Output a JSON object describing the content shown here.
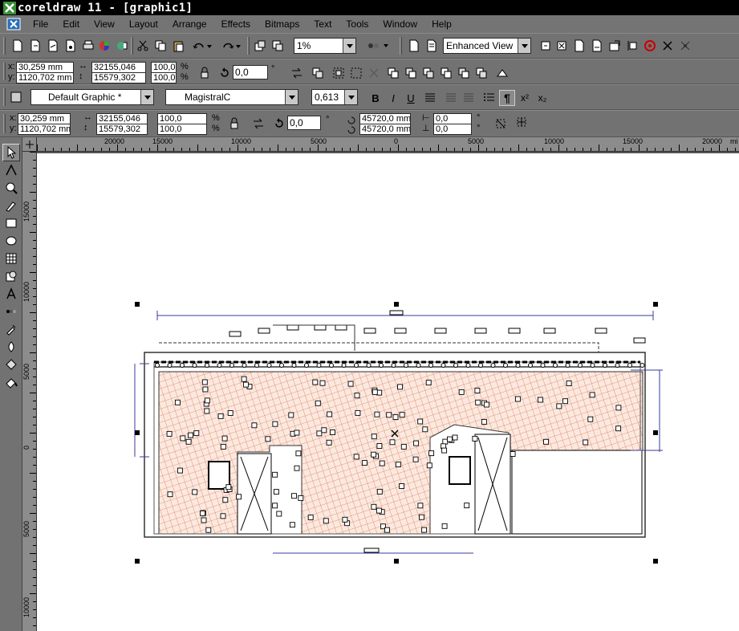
{
  "window": {
    "title": "coreldraw 11 - [graphic1]"
  },
  "menu": [
    "File",
    "Edit",
    "View",
    "Layout",
    "Arrange",
    "Effects",
    "Bitmaps",
    "Text",
    "Tools",
    "Window",
    "Help"
  ],
  "standard_toolbar": {
    "zoom_level": "1%",
    "view_mode": "Enhanced View"
  },
  "property_bar": {
    "x": "30,259 mm",
    "y": "1120,702 mm",
    "width": "32155,046",
    "height": "15579,302",
    "scale_x": "100,0",
    "scale_y": "100,0",
    "percent": "%",
    "rotation": "0,0",
    "degree": "°"
  },
  "text_bar": {
    "style": "Default Graphic *",
    "font": "MagistralC",
    "size": "0,613"
  },
  "object_bar": {
    "x_label": "x:",
    "y_label": "y:",
    "x": "30,259 mm",
    "y": "1120,702 mm",
    "width": "32155,046",
    "height": "15579,302",
    "scale_x": "100,0",
    "scale_y": "100,0",
    "rotation": "0,0",
    "center_x": "45720,0 mm",
    "center_y": "45720,0 mm",
    "skew_x": "0,0",
    "skew_y": "0,0"
  },
  "ruler": {
    "unit": "mi",
    "h_labels": [
      "20000",
      "15000",
      "10000",
      "5000",
      "0",
      "5000",
      "10000",
      "15000",
      "20000"
    ],
    "v_labels": [
      "15000",
      "10000",
      "5000",
      "0",
      "5000",
      "10000"
    ]
  },
  "colors": {
    "hatch": "#e07a5a",
    "hatch_fill": "#fbe9df",
    "dimension": "#3a3aa0"
  }
}
